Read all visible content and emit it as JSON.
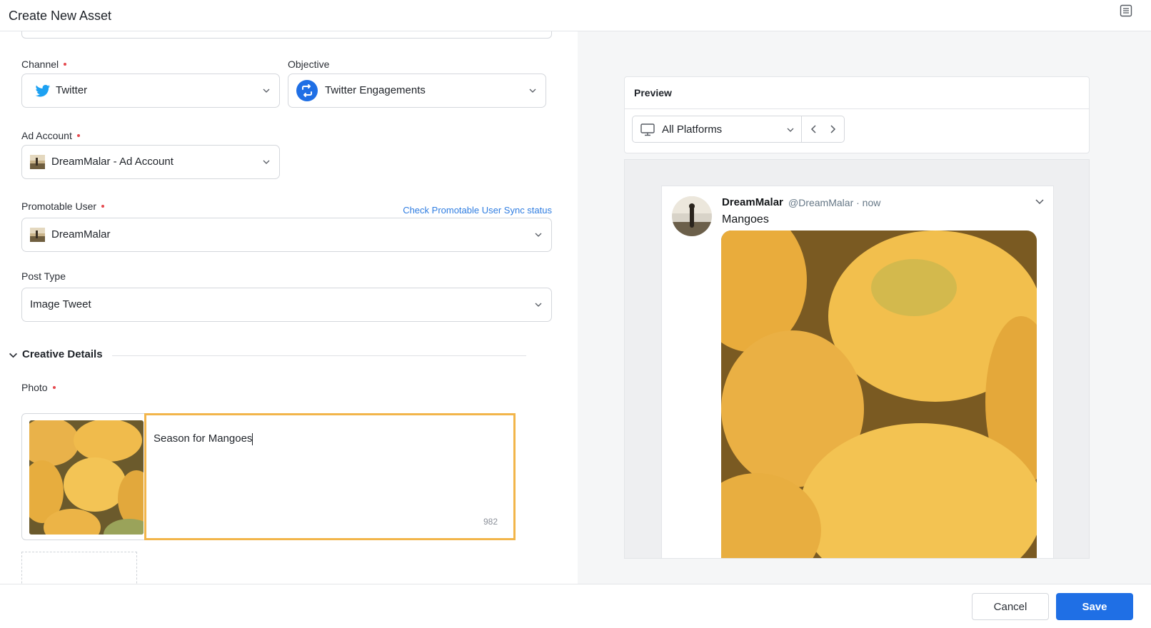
{
  "header": {
    "title": "Create New Asset",
    "menu_icon": "list-icon"
  },
  "form": {
    "channel": {
      "label": "Channel",
      "value": "Twitter",
      "icon": "twitter-icon"
    },
    "objective": {
      "label": "Objective",
      "value": "Twitter Engagements",
      "icon": "retweet-icon"
    },
    "ad_account": {
      "label": "Ad Account",
      "value": "DreamMalar - Ad Account"
    },
    "promotable_user": {
      "label": "Promotable User",
      "value": "DreamMalar",
      "link": "Check Promotable User Sync status"
    },
    "post_type": {
      "label": "Post Type",
      "value": "Image Tweet"
    },
    "creative_details": {
      "title": "Creative Details"
    },
    "photo": {
      "label": "Photo",
      "caption": "Season for Mangoes",
      "char_count": "982"
    }
  },
  "preview": {
    "title": "Preview",
    "platform": "All Platforms",
    "tweet": {
      "name": "DreamMalar",
      "handle": "@DreamMalar · now",
      "text": "Mangoes"
    }
  },
  "footer": {
    "cancel_label": "Cancel",
    "save_label": "Save"
  },
  "colors": {
    "accent": "#1f6fe5",
    "highlight": "#f2b54a",
    "twitter": "#1da1f2",
    "required": "#e5484d"
  }
}
